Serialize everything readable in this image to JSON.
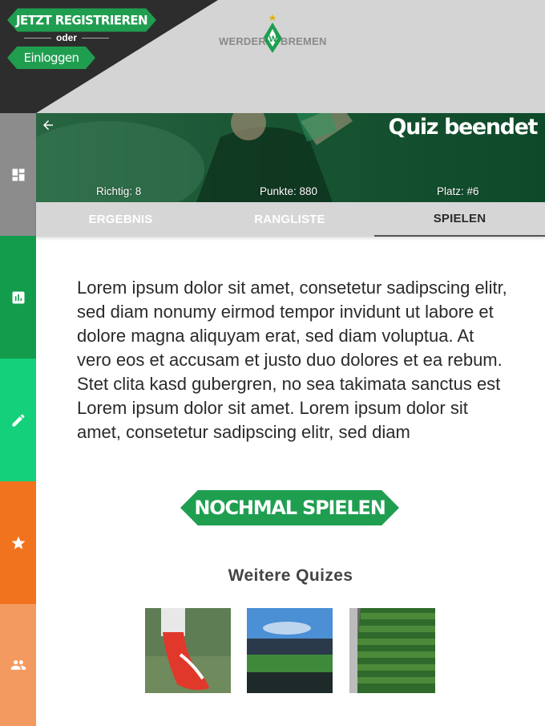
{
  "header": {
    "register_label": "JETZT REGISTRIEREN",
    "or_label": "oder",
    "login_label": "Einloggen",
    "logo_left": "WERDER",
    "logo_right": "BREMEN"
  },
  "sidebar": {
    "items": [
      {
        "icon": "dashboard-icon",
        "color": "#8c8c8c"
      },
      {
        "icon": "bar-chart-icon",
        "color": "#139c4c"
      },
      {
        "icon": "pencil-icon",
        "color": "#15d07a"
      },
      {
        "icon": "star-icon",
        "color": "#f2731e"
      },
      {
        "icon": "people-icon",
        "color": "#f39a60"
      }
    ]
  },
  "hero": {
    "title": "Quiz beendet",
    "stats": {
      "correct": "Richtig: 8",
      "points": "Punkte: 880",
      "rank": "Platz: #6"
    }
  },
  "tabs": [
    {
      "label": "ERGEBNIS",
      "active": false
    },
    {
      "label": "RANGLISTE",
      "active": false
    },
    {
      "label": "SPIELEN",
      "active": true
    }
  ],
  "content": {
    "body_text": "Lorem ipsum dolor sit amet, consetetur sadipscing elitr, sed diam nonumy eirmod tempor invidunt ut labore et dolore magna aliquyam erat, sed diam voluptua. At vero eos et accusam et justo duo dolores et ea rebum. Stet clita kasd gubergren, no sea takimata sanctus est Lorem ipsum dolor sit amet. Lorem ipsum dolor sit amet, consetetur sadipscing elitr, sed diam",
    "play_again_label": "NOCHMAL SPIELEN",
    "more_quizzes_title": "Weitere Quizes"
  },
  "colors": {
    "brand_green": "#1f9e50",
    "header_dark": "#2d2d2d",
    "header_light": "#d4d4d4"
  }
}
